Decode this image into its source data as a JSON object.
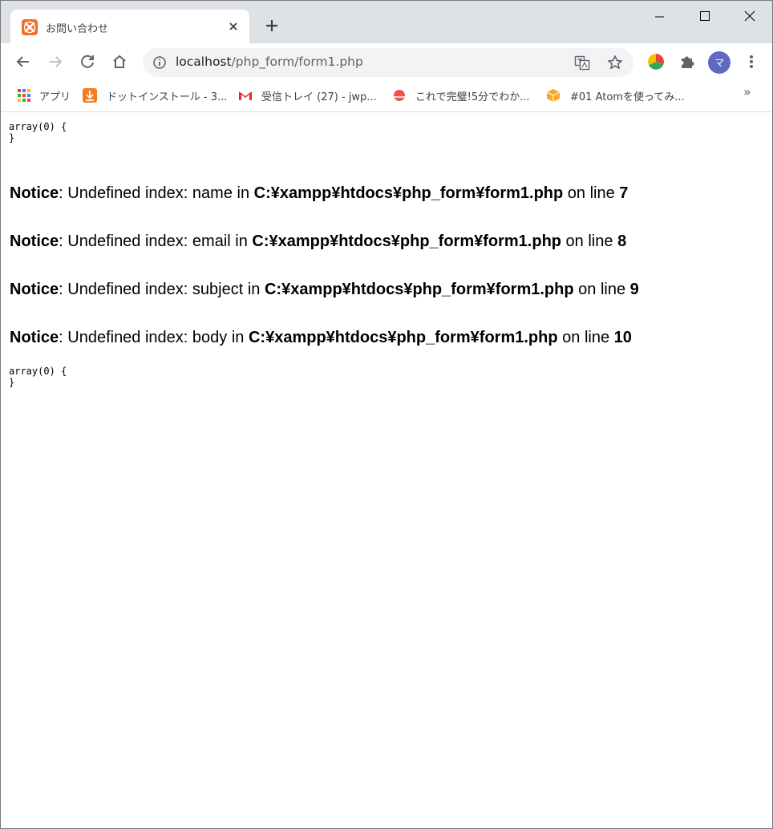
{
  "tab": {
    "title": "お問い合わせ"
  },
  "address_bar": {
    "host": "localhost",
    "path": "/php_form/form1.php"
  },
  "profile": {
    "initial": "マ"
  },
  "bookmarks": [
    {
      "label": "アプリ"
    },
    {
      "label": "ドットインストール - 3..."
    },
    {
      "label": "受信トレイ (27) - jwp..."
    },
    {
      "label": "これで完璧!5分でわか..."
    },
    {
      "label": "#01 Atomを使ってみ..."
    }
  ],
  "bookmarks_more": "»",
  "page": {
    "dump_top": "array(0) {\n}",
    "dump_bottom": "array(0) {\n}",
    "notices": [
      {
        "label": "Notice",
        "sep": ": ",
        "message": "Undefined index: name in ",
        "file": "C:¥xampp¥htdocs¥php_form¥form1.php",
        "on_line": " on line ",
        "line": "7"
      },
      {
        "label": "Notice",
        "sep": ": ",
        "message": "Undefined index: email in ",
        "file": "C:¥xampp¥htdocs¥php_form¥form1.php",
        "on_line": " on line ",
        "line": "8"
      },
      {
        "label": "Notice",
        "sep": ": ",
        "message": "Undefined index: subject in ",
        "file": "C:¥xampp¥htdocs¥php_form¥form1.php",
        "on_line": " on line ",
        "line": "9"
      },
      {
        "label": "Notice",
        "sep": ": ",
        "message": "Undefined index: body in ",
        "file": "C:¥xampp¥htdocs¥php_form¥form1.php",
        "on_line": " on line ",
        "line": "10"
      }
    ]
  },
  "colors": {
    "tabstrip": "#dee1e6",
    "omnibox": "#f1f3f4",
    "xampp_orange": "#f26b21",
    "avatar": "#5c6bc0"
  }
}
